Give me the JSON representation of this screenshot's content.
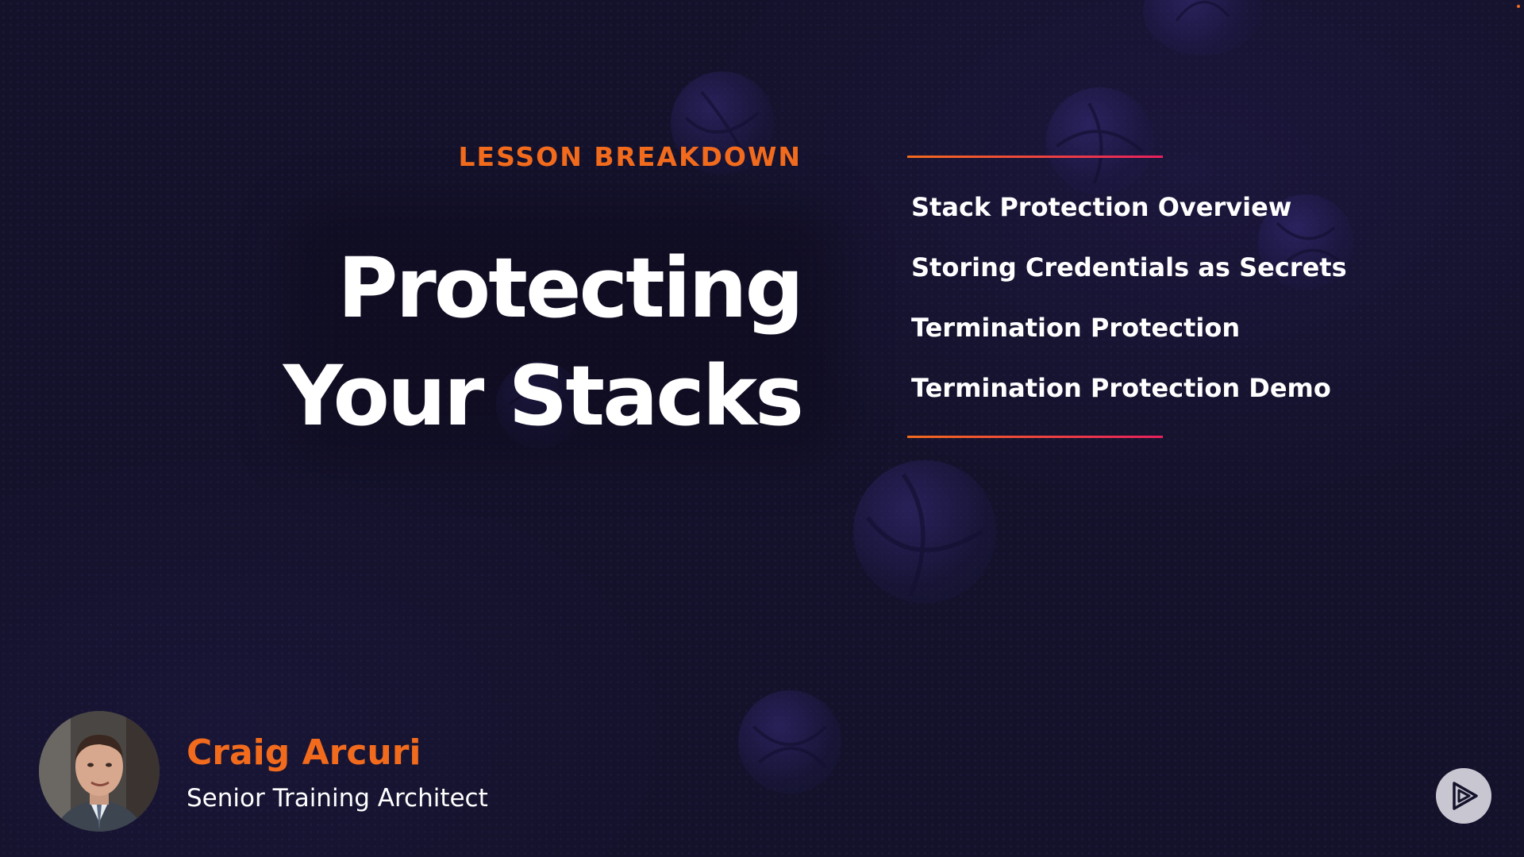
{
  "slide": {
    "section_label": "LESSON BREAKDOWN",
    "title_lines": [
      "Protecting",
      "Your Stacks"
    ],
    "topics": [
      "Stack Protection Overview",
      "Storing Credentials as Secrets",
      "Termination Protection",
      "Termination Protection Demo"
    ]
  },
  "presenter": {
    "name": "Craig Arcuri",
    "title": "Senior Training Architect"
  },
  "icons": {
    "brand_logo": "play-logo-icon",
    "avatar": "presenter-photo"
  },
  "colors": {
    "background": "#14122b",
    "accent_orange": "#f26b1d",
    "accent_pink": "#e8205e",
    "text_primary": "#ffffff",
    "logo_button": "#c8c7d1"
  }
}
